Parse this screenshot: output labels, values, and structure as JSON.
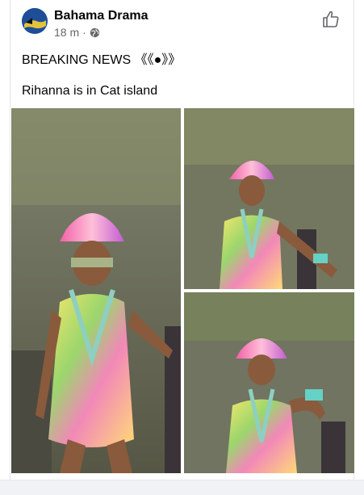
{
  "post": {
    "page_name": "Bahama Drama",
    "time": "18 m",
    "separator": "·",
    "privacy_icon": "globe-icon",
    "like_icon": "thumbs-up-icon",
    "line1": "BREAKING NEWS 《《●》》",
    "line2": "Rihanna is in Cat island"
  },
  "photos": {
    "count": 3
  },
  "colors": {
    "text": "#050505",
    "meta": "#65676b",
    "divider": "#e4e6eb"
  }
}
